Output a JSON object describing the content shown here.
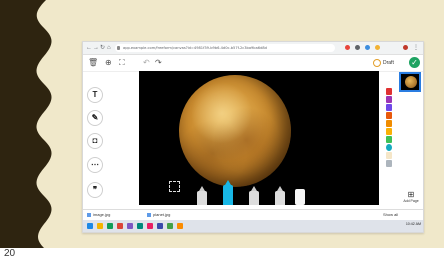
{
  "slide": {
    "page_number": "20",
    "background_color": "#f0e8ca",
    "border_color": "#2e2410"
  },
  "browser": {
    "url": "app.example.com/freeform/canvas?id=4981f39-b9b6-4d0c-b57f-2c3ba9ba6d8d",
    "nav_icons": [
      "back-arrow-icon",
      "forward-arrow-icon",
      "reload-icon",
      "home-icon"
    ],
    "extension_colors": [
      "#e8453c",
      "#5f6368",
      "#3c8dde",
      "#f2b233",
      "#5f6368"
    ]
  },
  "app_toolbar": {
    "icons": [
      "trash-icon",
      "zoom-in-icon",
      "fullscreen-icon",
      "undo-icon",
      "redo-icon"
    ],
    "draft_label": "Draft",
    "done_color": "#1ea362"
  },
  "side_tools": [
    {
      "name": "text-tool",
      "glyph": "T"
    },
    {
      "name": "pen-tool",
      "glyph": "✎"
    },
    {
      "name": "camera-tool",
      "glyph": "◘"
    },
    {
      "name": "more-tool",
      "glyph": "⋯"
    },
    {
      "name": "quote-tool",
      "glyph": "❞"
    }
  ],
  "canvas": {
    "image": "planet-venus",
    "background": "#000000"
  },
  "drawing_tools": [
    "lasso",
    "pen",
    "marker",
    "highlighter",
    "pencil",
    "eraser"
  ],
  "palette": [
    "#e03131",
    "#9c36b5",
    "#7048e8",
    "#e8590c",
    "#f08c00",
    "#fab005",
    "#40c057",
    "#15aabf",
    "#f5e6c8",
    "#adb5bd"
  ],
  "add_page_label": "Add Page",
  "downloads": [
    {
      "label": "image.jpg"
    },
    {
      "label": "planet.jpg"
    }
  ],
  "download_bar": {
    "show_all": "Show all"
  },
  "taskbar": {
    "app_colors": [
      "#1e88e5",
      "#f4b400",
      "#0f9d58",
      "#db4437",
      "#7e57c2",
      "#00897b",
      "#e91e63",
      "#3949ab",
      "#43a047",
      "#fb8c00"
    ],
    "time": "10:42 AM"
  }
}
